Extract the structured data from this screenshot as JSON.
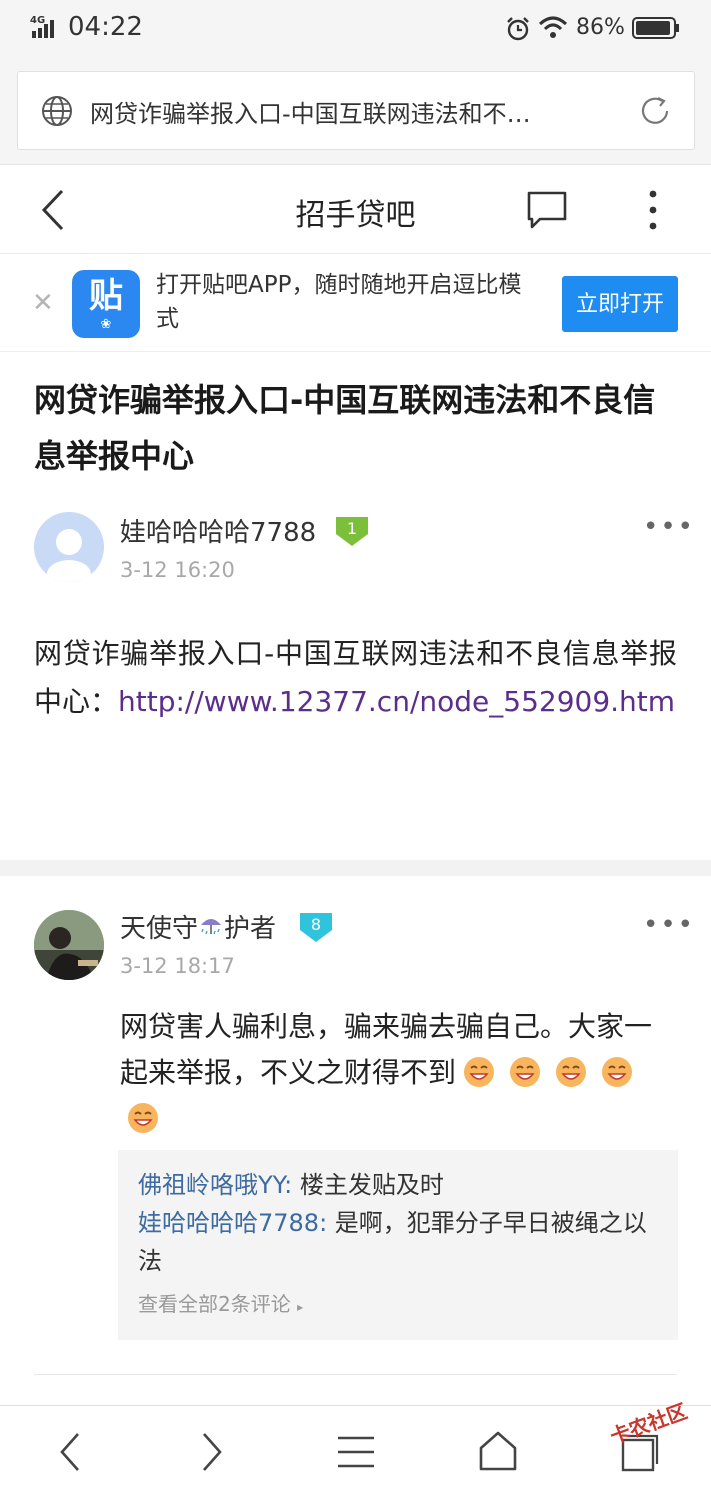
{
  "status_bar": {
    "network": "4G",
    "time": "04:22",
    "battery": "86%"
  },
  "browser": {
    "url_text": "网贷诈骗举报入口-中国互联网违法和不…"
  },
  "nav": {
    "title": "招手贷吧"
  },
  "app_banner": {
    "logo_text": "贴",
    "message": "打开贴吧APP，随时随地开启逗比模式",
    "open_button": "立即打开"
  },
  "post": {
    "title": "网贷诈骗举报入口-中国互联网违法和不良信息举报中心",
    "author": {
      "name": "娃哈哈哈哈7788",
      "level": "1",
      "time": "3-12 16:20"
    },
    "body_text": "网贷诈骗举报入口-中国互联网违法和不良信息举报中心：",
    "body_link": "http://www.12377.cn/node_552909.htm"
  },
  "reply": {
    "author": {
      "name_part1": "天使守",
      "name_part2": "护者",
      "level": "8",
      "time": "3-12 18:17"
    },
    "content": "网贷害人骗利息，骗来骗去骗自己。大家一起来举报，不义之财得不到",
    "sub_comments": [
      {
        "user": "佛祖岭咯哦YY:",
        "text": " 楼主发贴及时"
      },
      {
        "user": "娃哈哈哈哈7788:",
        "text": " 是啊，犯罪分子早日被绳之以法"
      }
    ],
    "view_all": "查看全部2条评论"
  },
  "watermark": "卡农社区",
  "colors": {
    "accent_blue": "#1e8cf0",
    "link_purple": "#5b2e8c",
    "sub_user_blue": "#3d6aa1",
    "level1_green": "#7cbf3b",
    "level8_cyan": "#2fc4dc"
  },
  "icons": [
    "signal-icon",
    "alarm-icon",
    "wifi-icon",
    "battery-icon",
    "globe-icon",
    "reload-icon",
    "back-icon",
    "comment-icon",
    "more-icon",
    "close-icon",
    "tieba-logo",
    "emoji-icon",
    "umbrella-icon",
    "nav-back-icon",
    "nav-forward-icon",
    "menu-icon",
    "home-icon",
    "tabs-icon"
  ]
}
